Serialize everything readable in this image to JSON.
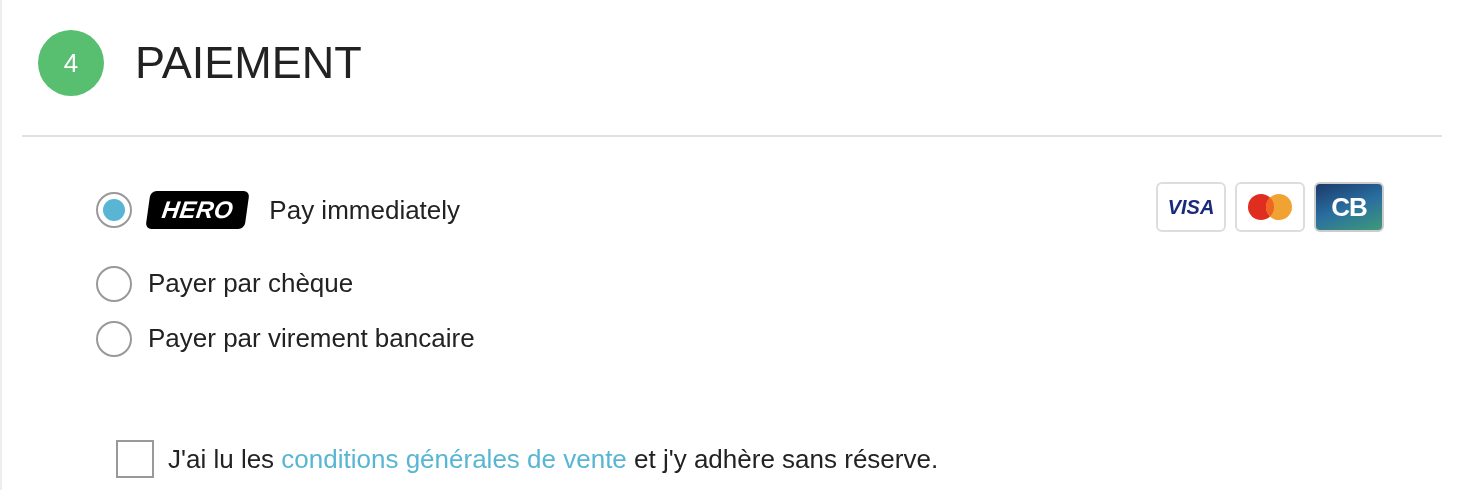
{
  "step": {
    "number": "4",
    "title": "PAIEMENT"
  },
  "payment_methods": [
    {
      "kind": "hero",
      "badge": "HERO",
      "label": "Pay immediately",
      "selected": true,
      "card_logos": [
        {
          "kind": "visa",
          "text": "VISA"
        },
        {
          "kind": "mastercard"
        },
        {
          "kind": "cb",
          "text": "CB"
        }
      ]
    },
    {
      "kind": "plain",
      "label": "Payer par chèque",
      "selected": false
    },
    {
      "kind": "plain",
      "label": "Payer par virement bancaire",
      "selected": false
    }
  ],
  "terms": {
    "checked": false,
    "before": "J'ai lu les",
    "link": "conditions générales de vente",
    "after": "et j'y adhère sans réserve."
  }
}
